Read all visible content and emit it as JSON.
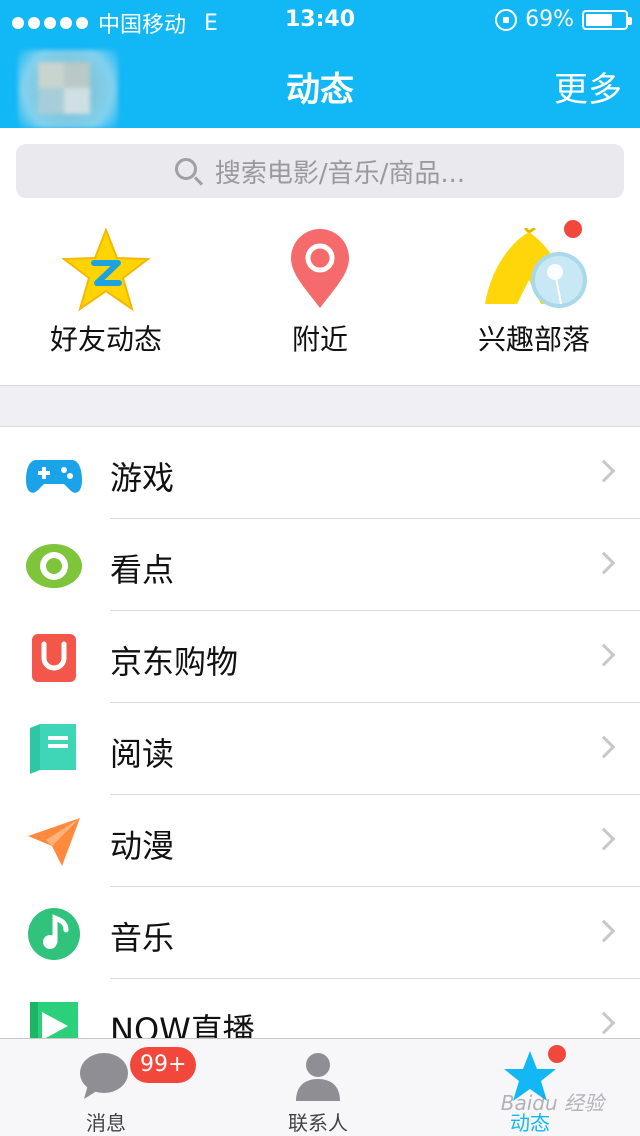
{
  "status_bar": {
    "carrier": "中国移动",
    "network": "E",
    "time": "13:40",
    "battery_text": "69%",
    "battery_level": 0.69
  },
  "nav": {
    "title": "动态",
    "more": "更多"
  },
  "search": {
    "placeholder": "搜索电影/音乐/商品..."
  },
  "shortcuts": [
    {
      "label": "好友动态",
      "icon": "star-q-icon"
    },
    {
      "label": "附近",
      "icon": "location-pin-icon"
    },
    {
      "label": "兴趣部落",
      "icon": "tribe-tent-icon"
    }
  ],
  "list": [
    {
      "label": "游戏",
      "icon": "gamepad-icon"
    },
    {
      "label": "看点",
      "icon": "eye-icon"
    },
    {
      "label": "京东购物",
      "icon": "shopping-bag-icon"
    },
    {
      "label": "阅读",
      "icon": "book-icon"
    },
    {
      "label": "动漫",
      "icon": "paper-plane-icon"
    },
    {
      "label": "音乐",
      "icon": "music-note-icon"
    },
    {
      "label": "NOW直播",
      "icon": "play-live-icon"
    }
  ],
  "tabs": [
    {
      "label": "消息",
      "badge": "99+"
    },
    {
      "label": "联系人"
    },
    {
      "label": "动态",
      "active": true
    }
  ],
  "watermark": "Baidu 经验",
  "colors": {
    "brand": "#12b7f5",
    "badge": "#f2483c"
  }
}
